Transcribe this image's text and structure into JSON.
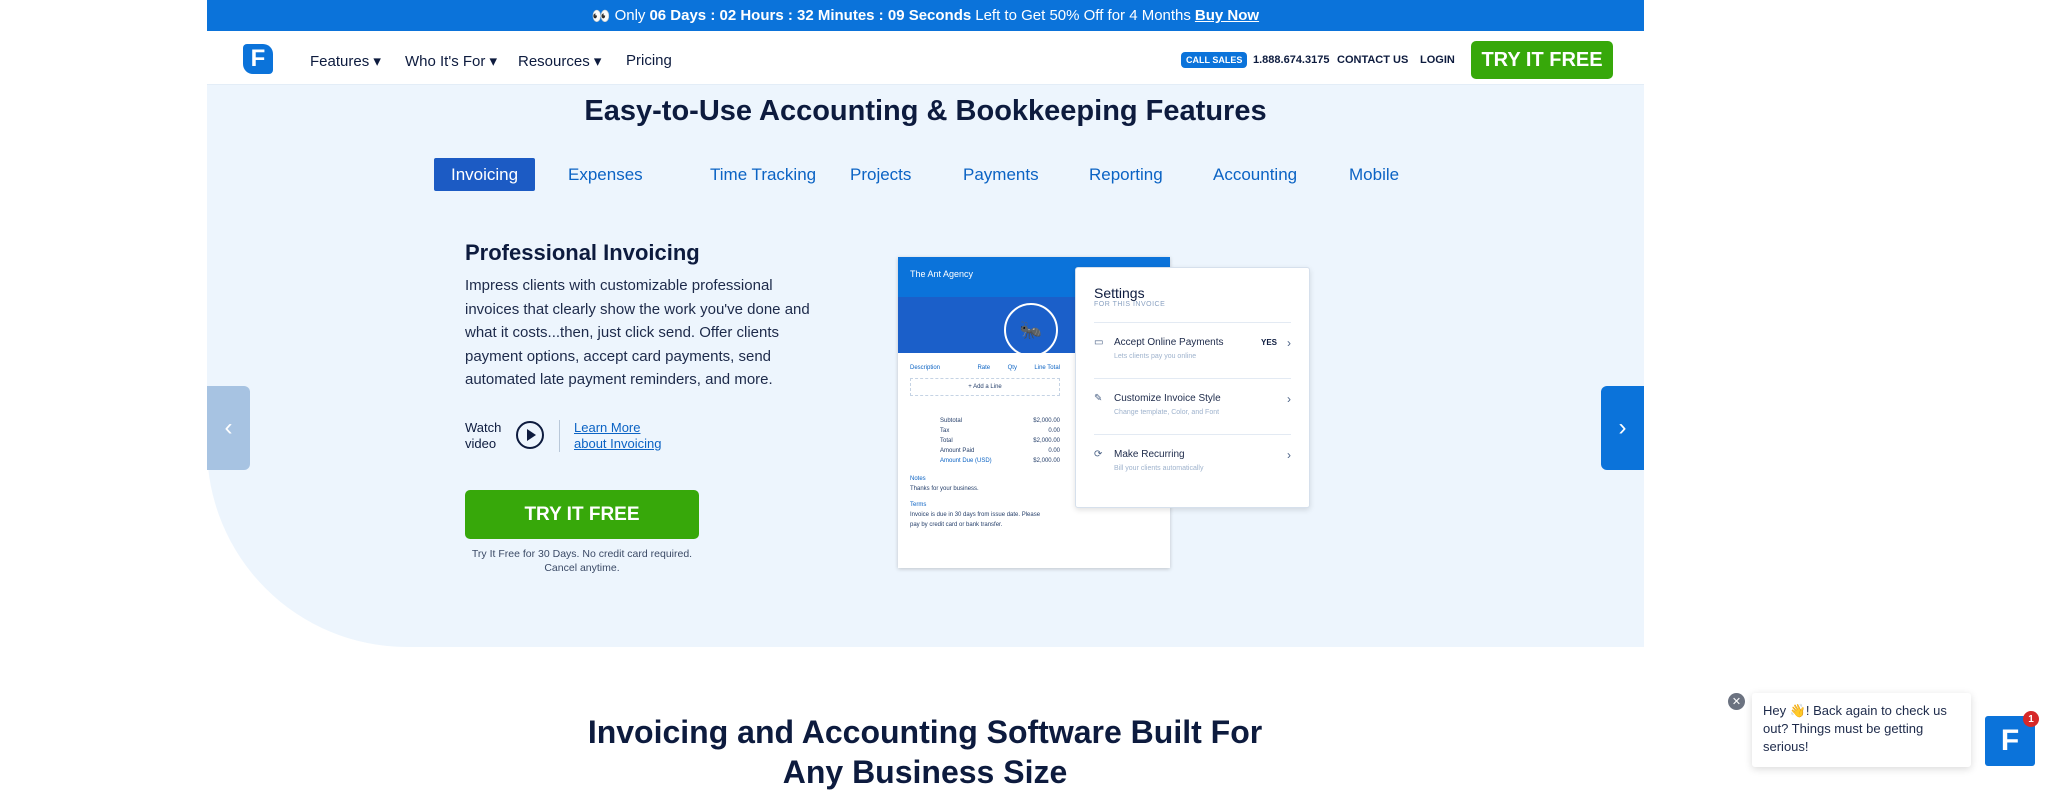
{
  "banner": {
    "icon": "eyes-icon",
    "pre": "Only",
    "countdown": "06 Days : 02 Hours : 32 Minutes : 09 Seconds",
    "post": "Left to Get 50% Off for 4 Months",
    "link": "Buy Now"
  },
  "nav": {
    "logo": "F",
    "items": [
      "Features",
      "Who It's For",
      "Resources",
      "Pricing"
    ],
    "call_sales": "CALL SALES",
    "phone": "1.888.674.3175",
    "contact": "CONTACT US",
    "login": "LOGIN",
    "cta": "TRY IT FREE"
  },
  "hero": {
    "title": "Easy-to-Use Accounting & Bookkeeping Features",
    "tabs": [
      "Invoicing",
      "Expenses",
      "Time Tracking",
      "Projects",
      "Payments",
      "Reporting",
      "Accounting",
      "Mobile"
    ],
    "active_tab": "Invoicing",
    "feature_title": "Professional Invoicing",
    "feature_text": "Impress clients with customizable professional invoices that clearly show the work you've done and what it costs...then, just click send. Offer clients payment options, accept card payments, send automated late payment reminders, and more.",
    "watch": "Watch video",
    "learn_more": "Learn More about Invoicing",
    "cta": "TRY IT FREE",
    "cta_note": "Try It Free for 30 Days. No credit card required. Cancel anytime."
  },
  "invoice": {
    "company": "The Ant Agency",
    "cols": [
      "Description",
      "Rate",
      "Qty",
      "Line Total"
    ],
    "add_line": "+ Add a Line",
    "subtotal": [
      "Subtotal",
      "$2,000.00"
    ],
    "tax": [
      "Tax",
      "0.00"
    ],
    "total": [
      "Total",
      "$2,000.00"
    ],
    "paid": [
      "Amount Paid",
      "0.00"
    ],
    "due": [
      "Amount Due (USD)",
      "$2,000.00"
    ],
    "notes_label": "Notes",
    "notes": "Thanks for your business.",
    "terms_label": "Terms",
    "terms": "Invoice is due in 30 days from issue date. Please pay by credit card or bank transfer."
  },
  "settings": {
    "title": "Settings",
    "subtitle": "FOR THIS INVOICE",
    "rows": [
      {
        "title": "Accept Online Payments",
        "desc": "Lets clients pay you online",
        "value": "YES"
      },
      {
        "title": "Customize Invoice Style",
        "desc": "Change template, Color, and Font"
      },
      {
        "title": "Make Recurring",
        "desc": "Bill your clients automatically"
      }
    ]
  },
  "section2": {
    "title": "Invoicing and Accounting Software Built For Any Business Size"
  },
  "chat": {
    "message": "Hey 👋! Back again to check us out? Things must be getting serious!",
    "badge": "1",
    "logo": "F"
  },
  "colors": {
    "brand": "#0b73da",
    "cta": "#37a80a",
    "hero_bg": "#edf5fd"
  }
}
